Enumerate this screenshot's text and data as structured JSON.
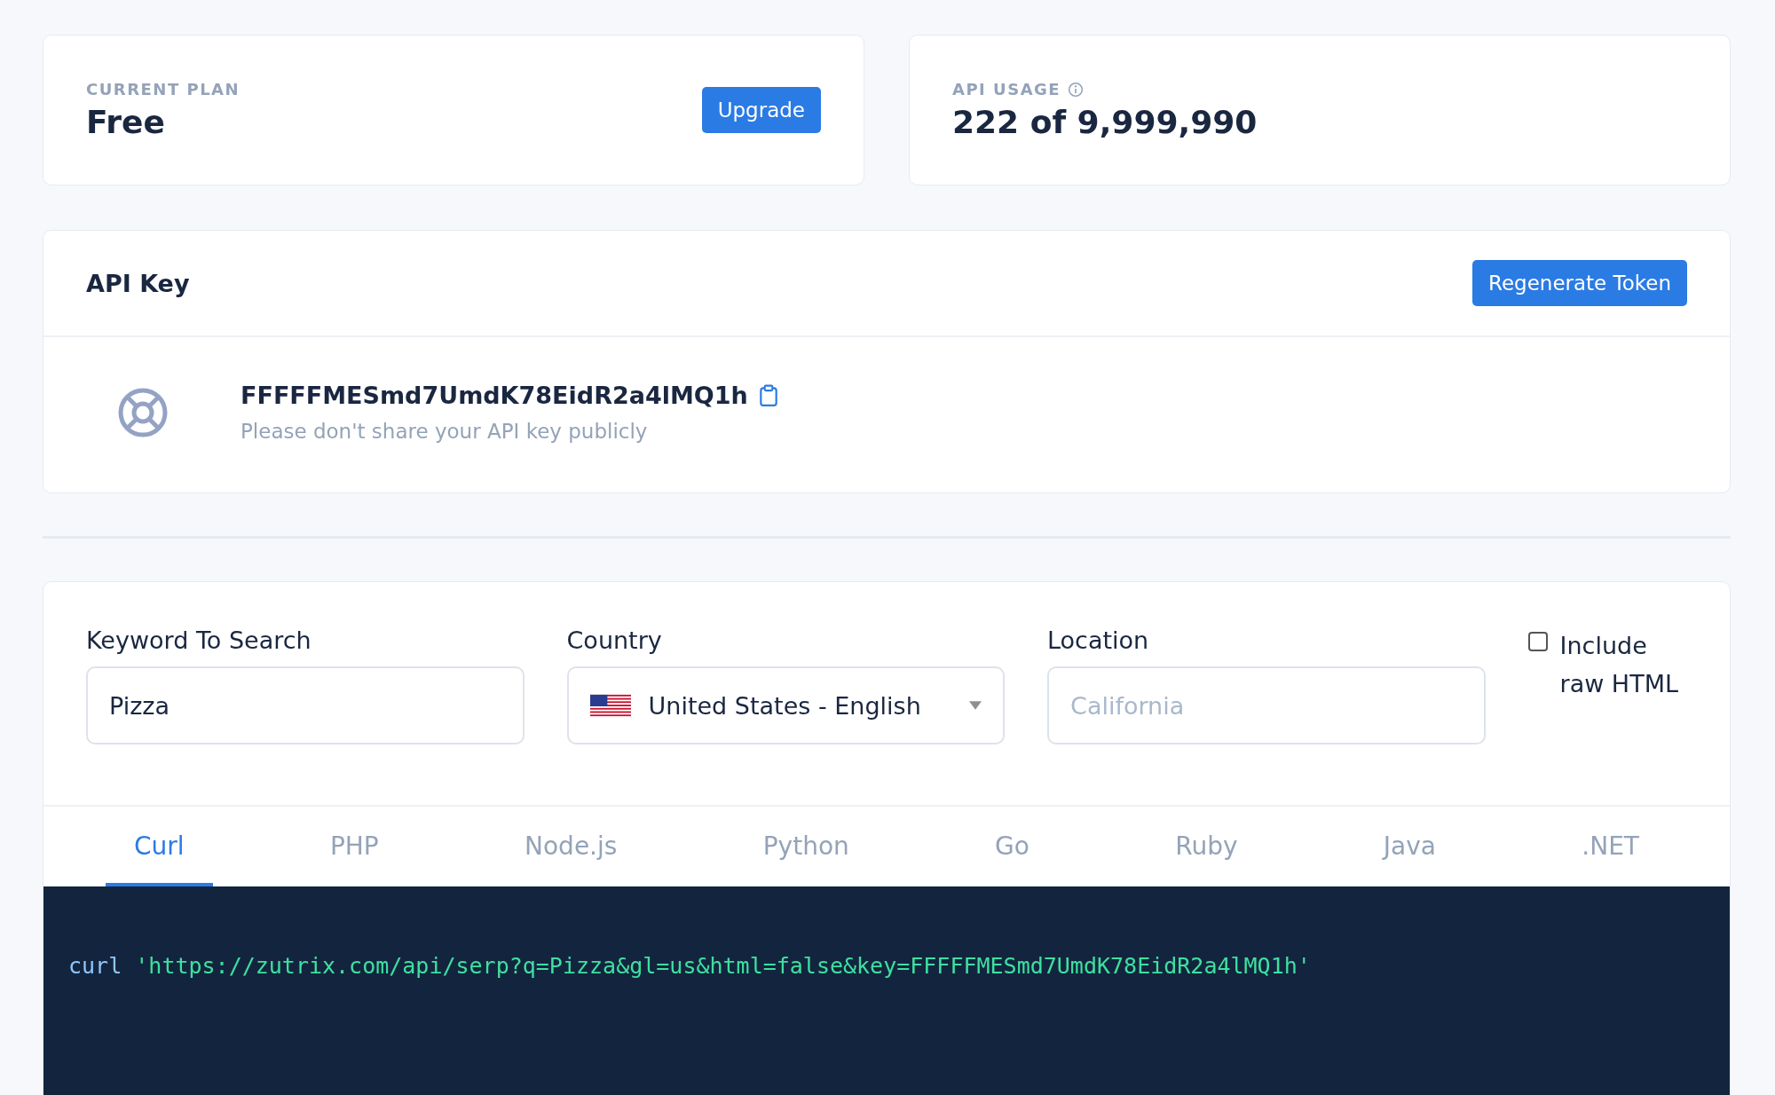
{
  "plan": {
    "label": "CURRENT PLAN",
    "value": "Free",
    "button": "Upgrade"
  },
  "usage": {
    "label": "API USAGE",
    "value": "222 of 9,999,990"
  },
  "api_key": {
    "title": "API Key",
    "button": "Regenerate Token",
    "key": "FFFFFMESmd7UmdK78EidR2a4lMQ1h",
    "hint": "Please don't share your API key publicly"
  },
  "form": {
    "keyword": {
      "label": "Keyword To Search",
      "value": "Pizza"
    },
    "country": {
      "label": "Country",
      "value": "United States - English"
    },
    "location": {
      "label": "Location",
      "placeholder": "California"
    },
    "raw_html": {
      "label": "Include raw HTML",
      "checked": false
    }
  },
  "tabs": [
    {
      "label": "Curl",
      "selected": true
    },
    {
      "label": "PHP",
      "selected": false
    },
    {
      "label": "Node.js",
      "selected": false
    },
    {
      "label": "Python",
      "selected": false
    },
    {
      "label": "Go",
      "selected": false
    },
    {
      "label": "Ruby",
      "selected": false
    },
    {
      "label": "Java",
      "selected": false
    },
    {
      "label": ".NET",
      "selected": false
    }
  ],
  "code": {
    "command": "curl",
    "argument": "'https://zutrix.com/api/serp?q=Pizza&gl=us&html=false&key=FFFFFMESmd7UmdK78EidR2a4lMQ1h'"
  }
}
